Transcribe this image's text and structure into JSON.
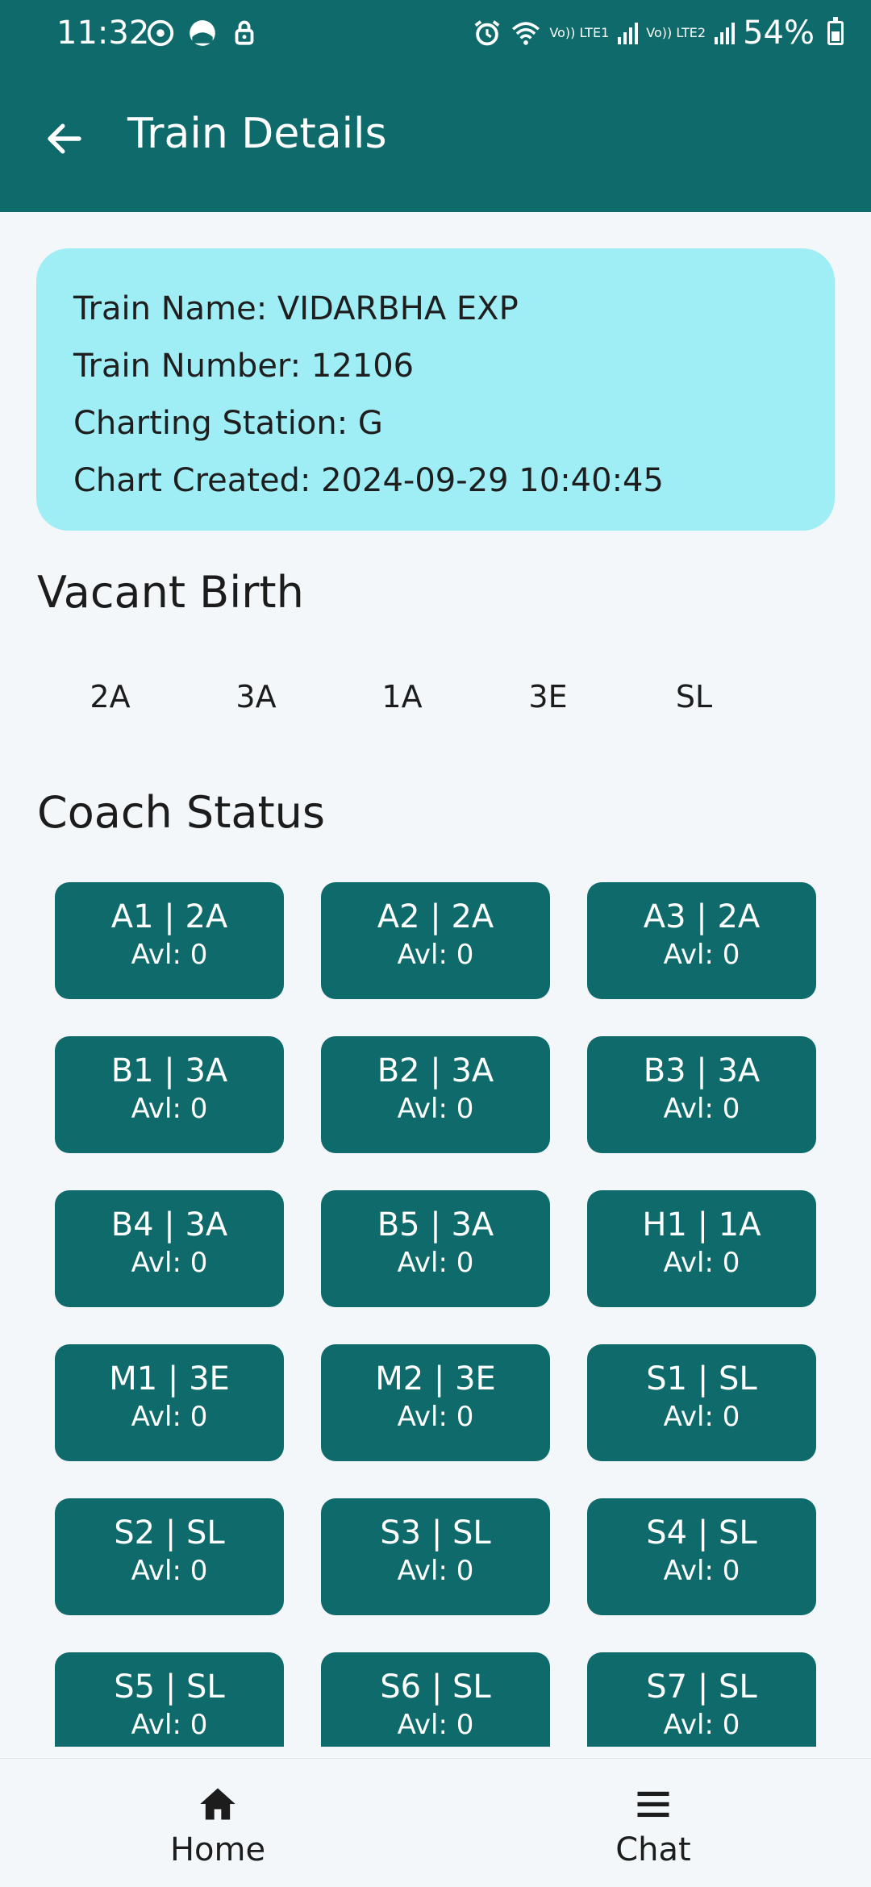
{
  "status_bar": {
    "time": "11:32",
    "battery": "54%",
    "net1": "Vo)) LTE1",
    "net2": "Vo)) LTE2"
  },
  "header": {
    "title": "Train Details",
    "back_icon": "arrow-left-icon"
  },
  "train_info": {
    "name": "Train Name: VIDARBHA EXP",
    "number": "Train Number: 12106",
    "charting_station": "Charting Station: G",
    "chart_created": "Chart Created: 2024-09-29 10:40:45"
  },
  "vacant": {
    "title": "Vacant Birth",
    "classes": [
      "2A",
      "3A",
      "1A",
      "3E",
      "SL"
    ]
  },
  "coach_status": {
    "title": "Coach Status",
    "coaches": [
      {
        "name": "A1 | 2A",
        "avl": "Avl: 0"
      },
      {
        "name": "A2 | 2A",
        "avl": "Avl: 0"
      },
      {
        "name": "A3 | 2A",
        "avl": "Avl: 0"
      },
      {
        "name": "B1 | 3A",
        "avl": "Avl: 0"
      },
      {
        "name": "B2 | 3A",
        "avl": "Avl: 0"
      },
      {
        "name": "B3 | 3A",
        "avl": "Avl: 0"
      },
      {
        "name": "B4 | 3A",
        "avl": "Avl: 0"
      },
      {
        "name": "B5 | 3A",
        "avl": "Avl: 0"
      },
      {
        "name": "H1 | 1A",
        "avl": "Avl: 0"
      },
      {
        "name": "M1 | 3E",
        "avl": "Avl: 0"
      },
      {
        "name": "M2 | 3E",
        "avl": "Avl: 0"
      },
      {
        "name": "S1 | SL",
        "avl": "Avl: 0"
      },
      {
        "name": "S2 | SL",
        "avl": "Avl: 0"
      },
      {
        "name": "S3 | SL",
        "avl": "Avl: 0"
      },
      {
        "name": "S4 | SL",
        "avl": "Avl: 0"
      },
      {
        "name": "S5 | SL",
        "avl": "Avl: 0"
      },
      {
        "name": "S6 | SL",
        "avl": "Avl: 0"
      },
      {
        "name": "S7 | SL",
        "avl": "Avl: 0"
      }
    ]
  },
  "bottom_nav": {
    "home": {
      "label": "Home",
      "icon": "home-icon"
    },
    "chat": {
      "label": "Chat",
      "icon": "menu-icon"
    }
  },
  "colors": {
    "primary": "#0f6b6b",
    "card": "#9fedf5",
    "background": "#f3f7f9"
  }
}
